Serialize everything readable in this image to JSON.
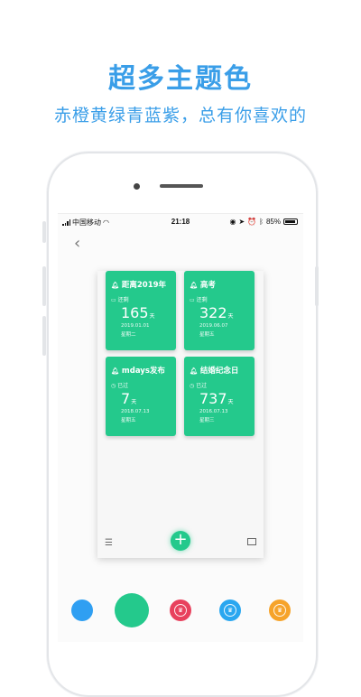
{
  "promo": {
    "title": "超多主题色",
    "subtitle": "赤橙黄绿青蓝紫，总有你喜欢的"
  },
  "status_bar": {
    "carrier": "中国移动",
    "time": "21:18",
    "battery": "85%"
  },
  "tiles": [
    {
      "title": "距离2019年",
      "status": "还剩",
      "value": "165",
      "unit": "天",
      "date": "2019.01.01",
      "weekday": "星期二"
    },
    {
      "title": "高考",
      "status": "还剩",
      "value": "322",
      "unit": "天",
      "date": "2019.06.07",
      "weekday": "星期五"
    },
    {
      "title": "mdays发布",
      "status": "已过",
      "value": "7",
      "unit": "天",
      "date": "2018.07.13",
      "weekday": "星期五"
    },
    {
      "title": "结婚纪念日",
      "status": "已过",
      "value": "737",
      "unit": "天",
      "date": "2016.07.13",
      "weekday": "星期三"
    }
  ],
  "colors": {
    "accent_blue": "#3a9ee8",
    "tile_green": "#24c98c",
    "swatches": [
      "#2f9ff2",
      "#24c98c",
      "#e8415d",
      "#2aa7f0",
      "#f6a32a"
    ]
  }
}
